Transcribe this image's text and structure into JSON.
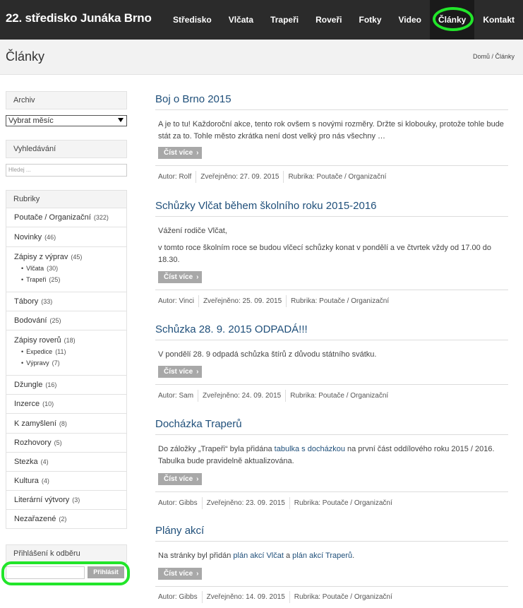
{
  "header": {
    "brand": "22. středisko Junáka Brno",
    "nav": [
      "Středisko",
      "Vlčata",
      "Trapeři",
      "Roveři",
      "Fotky",
      "Video",
      "Články",
      "Kontakt"
    ]
  },
  "titlebar": {
    "title": "Články",
    "breadcrumb_home": "Domů",
    "breadcrumb_sep": " / ",
    "breadcrumb_current": "Články"
  },
  "sidebar": {
    "archive_title": "Archiv",
    "archive_select": "Vybrat měsíc",
    "search_title": "Vyhledávání",
    "search_placeholder": "Hledej ...",
    "categories_title": "Rubriky",
    "categories": [
      {
        "name": "Poutače / Organizační",
        "count": "(322)"
      },
      {
        "name": "Novinky",
        "count": "(46)"
      },
      {
        "name": "Zápisy z výprav",
        "count": "(45)",
        "sub": [
          {
            "name": "Vlčata",
            "count": "(30)"
          },
          {
            "name": "Trapeři",
            "count": "(25)"
          }
        ]
      },
      {
        "name": "Tábory",
        "count": "(33)"
      },
      {
        "name": "Bodování",
        "count": "(25)"
      },
      {
        "name": "Zápisy roverů",
        "count": "(18)",
        "sub": [
          {
            "name": "Expedice",
            "count": "(11)"
          },
          {
            "name": "Výpravy",
            "count": "(7)"
          }
        ]
      },
      {
        "name": "Džungle",
        "count": "(16)"
      },
      {
        "name": "Inzerce",
        "count": "(10)"
      },
      {
        "name": "K zamyšlení",
        "count": "(8)"
      },
      {
        "name": "Rozhovory",
        "count": "(5)"
      },
      {
        "name": "Stezka",
        "count": "(4)"
      },
      {
        "name": "Kultura",
        "count": "(4)"
      },
      {
        "name": "Literární výtvory",
        "count": "(3)"
      },
      {
        "name": "Nezařazené",
        "count": "(2)"
      }
    ],
    "subscribe_title": "Přihlášení k odběru",
    "subscribe_button": "Přihlásit"
  },
  "posts": [
    {
      "title": "Boj o Brno 2015",
      "paragraphs": [
        "A je to tu! Každoroční akce, tento rok ovšem s novými rozměry. Držte si klobouky, protože tohle bude stát za to.  Tohle město zkrátka není dost velký pro nás všechny …"
      ],
      "more": "Číst více",
      "author": "Autor: Rolf",
      "published": "Zveřejněno: 27. 09. 2015",
      "category": "Rubrika: Poutače / Organizační"
    },
    {
      "title": "Schůzky Vlčat během školního roku 2015-2016",
      "paragraphs": [
        "Vážení rodiče Vlčat,",
        "v tomto roce školním roce se budou vlčecí schůzky konat v pondělí a ve čtvrtek vždy od 17.00 do 18.30."
      ],
      "more": "Číst více",
      "author": "Autor: Vinci",
      "published": "Zveřejněno: 25. 09. 2015",
      "category": "Rubrika: Poutače / Organizační"
    },
    {
      "title": "Schůzka 28. 9. 2015 ODPADÁ!!!",
      "paragraphs": [
        "V pondělí 28. 9 odpadá schůzka štírů z důvodu státního svátku."
      ],
      "more": "Číst více",
      "author": "Autor: Sam",
      "published": "Zveřejněno: 24. 09. 2015",
      "category": "Rubrika: Poutače / Organizační"
    },
    {
      "title": "Docházka Traperů",
      "p4_before": "Do záložky „Trapeři“ byla přidána ",
      "p4_link": "tabulka s docházkou",
      "p4_after": " na první část oddílového roku 2015 / 2016. Tabulka bude pravidelně aktualizována.",
      "more": "Číst více",
      "author": "Autor: Gibbs",
      "published": "Zveřejněno: 23. 09. 2015",
      "category": "Rubrika: Poutače / Organizační"
    },
    {
      "title": "Plány akcí",
      "p5_before": "Na stránky byl přidán ",
      "p5_link1": "plán akcí Vlčat",
      "p5_mid": " a ",
      "p5_link2": "plán akcí Traperů",
      "p5_after": ".",
      "more": "Číst více",
      "author": "Autor: Gibbs",
      "published": "Zveřejněno: 14. 09. 2015",
      "category": "Rubrika: Poutače / Organizační"
    }
  ],
  "colors": {
    "topbar": "#2b2b2b",
    "highlight": "#22e52a",
    "link": "#1f4f7a",
    "button": "#a8a8a8"
  }
}
